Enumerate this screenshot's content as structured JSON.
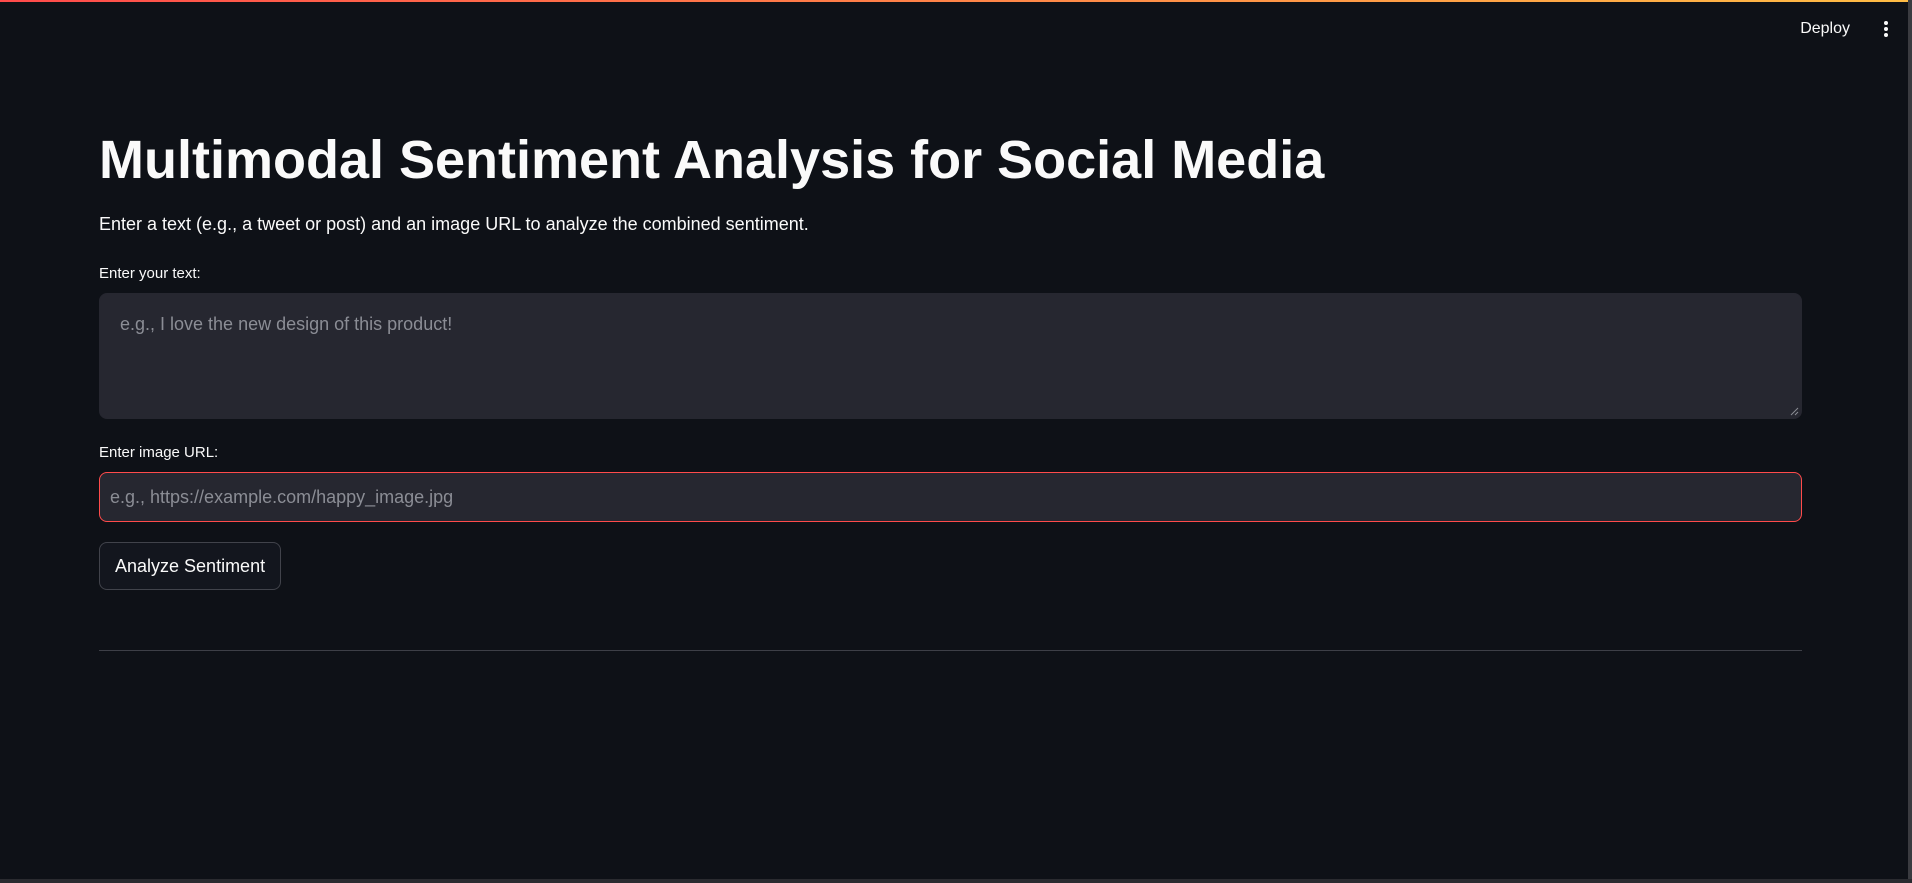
{
  "header": {
    "deploy_label": "Deploy",
    "menu_icon": "more-vertical-icon"
  },
  "theme": {
    "background": "#0e1117",
    "input_background": "#262730",
    "error_border": "#ff4b4b",
    "decoration_gradient": [
      "#ff4b4b",
      "#ffbd45"
    ]
  },
  "main": {
    "title": "Multimodal Sentiment Analysis for Social Media",
    "description": "Enter a text (e.g., a tweet or post) and an image URL to analyze the combined sentiment.",
    "text_field": {
      "label": "Enter your text:",
      "value": "",
      "placeholder": "e.g., I love the new design of this product!"
    },
    "url_field": {
      "label": "Enter image URL:",
      "value": "",
      "placeholder": "e.g., https://example.com/happy_image.jpg"
    },
    "analyze_button_label": "Analyze Sentiment"
  }
}
